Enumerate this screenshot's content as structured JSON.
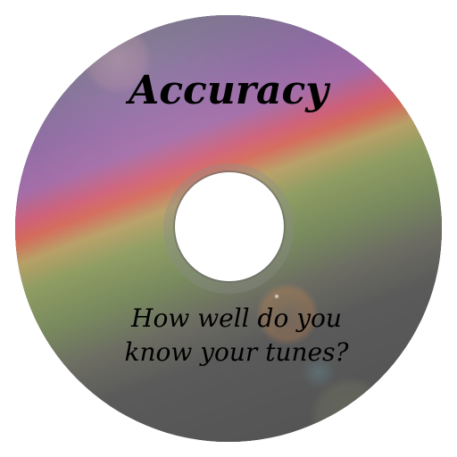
{
  "app_icon": {
    "title": "Accuracy",
    "tagline_line1": "How well do you",
    "tagline_line2": "know your tunes?"
  },
  "colors": {
    "disc_base": "#525252",
    "text": "#000000",
    "hole": "#ffffff"
  },
  "icons": {
    "main": "compact-disc-icon"
  }
}
